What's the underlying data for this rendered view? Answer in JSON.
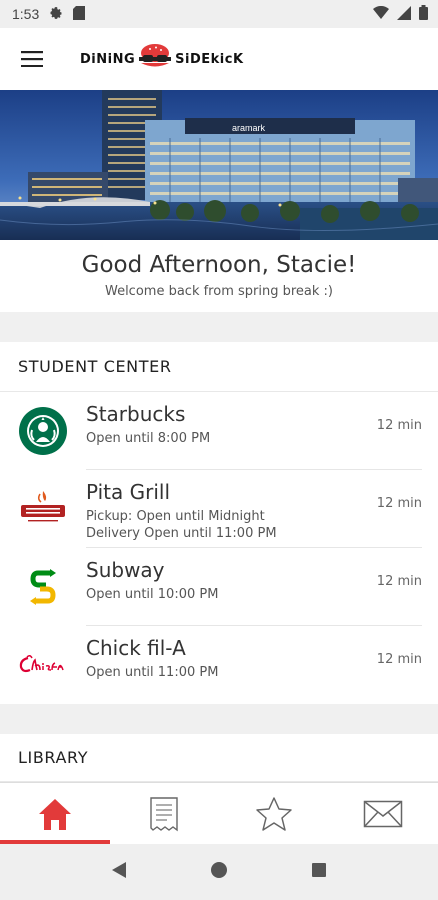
{
  "status_bar": {
    "time": "1:53"
  },
  "app": {
    "logo_left": "DiNiNG",
    "logo_right": "SiDEkicK"
  },
  "greeting": {
    "title": "Good Afternoon, Stacie!",
    "subtitle": "Welcome back from spring break :)"
  },
  "sections": [
    {
      "title": "STUDENT CENTER",
      "items": [
        {
          "name": "Starbucks",
          "info": [
            "Open until 8:00 PM"
          ],
          "time": "12 min",
          "logo": "starbucks-logo"
        },
        {
          "name": "Pita Grill",
          "info": [
            "Pickup: Open until Midnight",
            "Delivery Open until 11:00 PM"
          ],
          "time": "12 min",
          "logo": "pita-grill-logo"
        },
        {
          "name": "Subway",
          "info": [
            "Open until 10:00 PM"
          ],
          "time": "12 min",
          "logo": "subway-logo"
        },
        {
          "name": "Chick fil-A",
          "info": [
            "Open until 11:00 PM"
          ],
          "time": "12 min",
          "logo": "chick-fil-a-logo"
        }
      ]
    },
    {
      "title": "LIBRARY"
    }
  ],
  "hero": {
    "building_sign": "aramark"
  },
  "bottom_nav": [
    {
      "icon": "home-icon",
      "active": true
    },
    {
      "icon": "receipt-icon",
      "active": false
    },
    {
      "icon": "star-icon",
      "active": false
    },
    {
      "icon": "mail-icon",
      "active": false
    }
  ],
  "colors": {
    "accent": "#e23a3a",
    "starbucks": "#00704a",
    "subway_green": "#008c15",
    "subway_yellow": "#f2b700"
  }
}
